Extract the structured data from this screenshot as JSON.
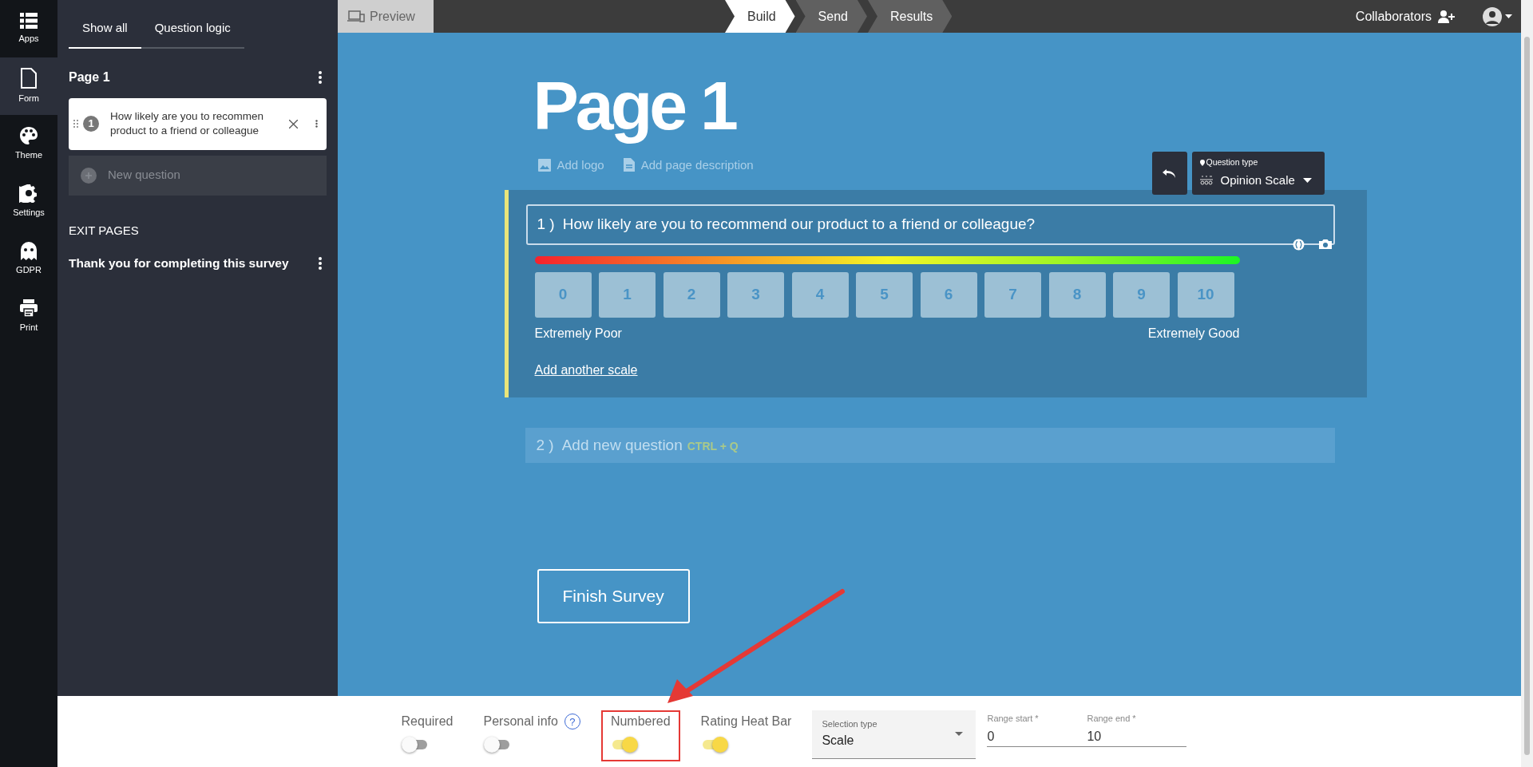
{
  "rail": [
    {
      "label": "Apps",
      "selected": false
    },
    {
      "label": "Form",
      "selected": true
    },
    {
      "label": "Theme",
      "selected": false
    },
    {
      "label": "Settings",
      "selected": false
    },
    {
      "label": "GDPR",
      "selected": false
    },
    {
      "label": "Print",
      "selected": false
    }
  ],
  "panel": {
    "tabs": [
      {
        "label": "Show all",
        "selected": true
      },
      {
        "label": "Question logic",
        "selected": false
      }
    ],
    "page_title": "Page 1",
    "questions": [
      {
        "number": "1",
        "text": "How likely are you to recommen\nproduct to a friend or colleague"
      }
    ],
    "new_question": "New question",
    "exit_heading": "EXIT PAGES",
    "exit_pages": [
      "Thank you for completing this survey"
    ]
  },
  "topbar": {
    "preview": "Preview",
    "steps": [
      {
        "label": "Build",
        "selected": true
      },
      {
        "label": "Send",
        "selected": false
      },
      {
        "label": "Results",
        "selected": false
      }
    ],
    "collaborators": "Collaborators"
  },
  "editor": {
    "page_title": "Page 1",
    "add_logo": "Add logo",
    "add_page_description": "Add page description",
    "question_type": {
      "label": "Question type",
      "value": "Opinion Scale"
    },
    "question": {
      "number": "1 )",
      "text": "How likely are you to recommend our product to a friend or colleague?"
    },
    "scale": [
      "0",
      "1",
      "2",
      "3",
      "4",
      "5",
      "6",
      "7",
      "8",
      "9",
      "10"
    ],
    "low_label": "Extremely Poor",
    "high_label": "Extremely Good",
    "add_scale": "Add another scale",
    "next_question": {
      "number": "2 )",
      "placeholder": "Add new question",
      "shortcut": "CTRL + Q"
    },
    "finish": "Finish Survey"
  },
  "settings": {
    "toggles": [
      {
        "label": "Required",
        "on": false,
        "highlighted": false
      },
      {
        "label": "Personal info",
        "on": false,
        "help": "?",
        "highlighted": false
      },
      {
        "label": "Numbered",
        "on": true,
        "highlighted": true
      },
      {
        "label": "Rating Heat Bar",
        "on": true,
        "highlighted": false
      }
    ],
    "selection_type": {
      "label": "Selection type",
      "value": "Scale"
    },
    "ranges": [
      {
        "label": "Range start *",
        "value": "0"
      },
      {
        "label": "Range end *",
        "value": "10"
      }
    ]
  }
}
